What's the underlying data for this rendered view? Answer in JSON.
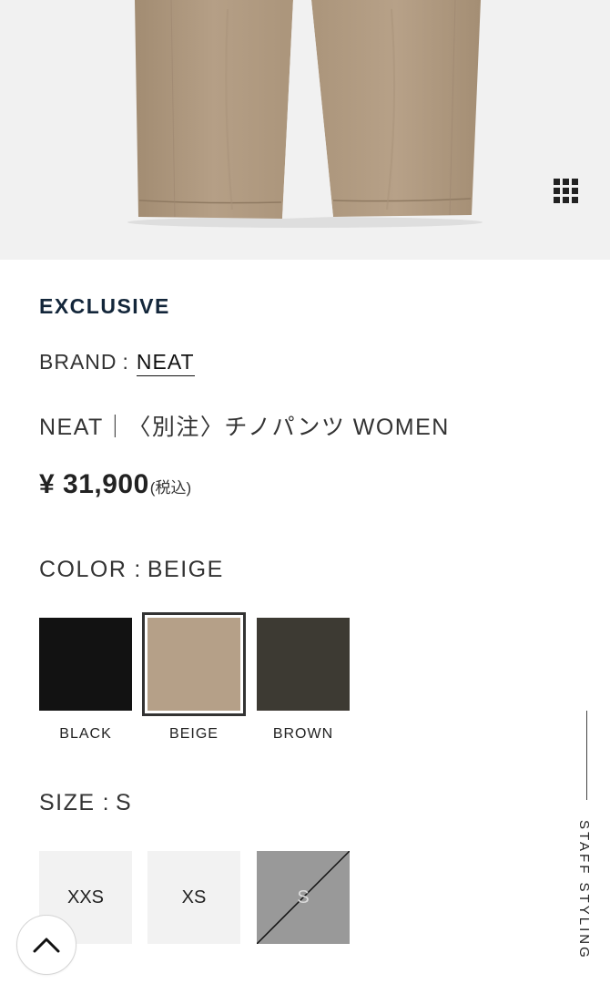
{
  "product": {
    "tag": "EXCLUSIVE",
    "brand_label": "BRAND",
    "brand_sep": ":",
    "brand_name": "NEAT",
    "name": "NEAT｜〈別注〉チノパンツ WOMEN",
    "price": "¥ 31,900",
    "tax_note": "(税込)"
  },
  "color": {
    "label": "COLOR",
    "sep": ":",
    "selected": "BEIGE",
    "options": [
      {
        "label": "BLACK",
        "hex": "#121212"
      },
      {
        "label": "BEIGE",
        "hex": "#b5a088"
      },
      {
        "label": "BROWN",
        "hex": "#3d3a33"
      }
    ]
  },
  "size": {
    "label": "SIZE",
    "sep": ":",
    "selected": "S",
    "options": [
      {
        "label": "XXS",
        "available": true
      },
      {
        "label": "XS",
        "available": true
      },
      {
        "label": "S",
        "available": false
      }
    ]
  },
  "staff_styling": "STAFF STYLING",
  "icons": {
    "gallery": "grid-icon",
    "back_to_top": "chevron-up-icon"
  },
  "colors": {
    "brand_navy": "#13263a",
    "hero_bg": "#f1f1f1",
    "soldout_bg": "#999999"
  }
}
